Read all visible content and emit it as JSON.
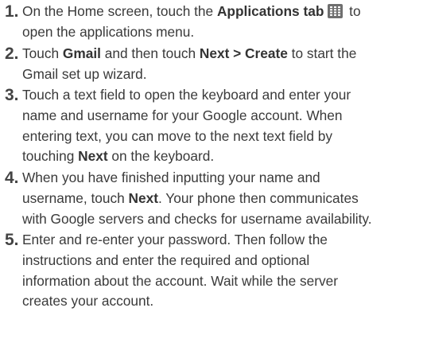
{
  "steps": [
    {
      "number": "1.",
      "lines": [
        {
          "segments": [
            "On the Home screen, touch the ",
            "Applications tab",
            "",
            " to"
          ]
        },
        {
          "segments": [
            "open the applications menu."
          ]
        }
      ],
      "icon": "apps-grid-icon"
    },
    {
      "number": "2.",
      "lines": [
        {
          "segments": [
            "Touch ",
            "Gmail",
            " and then touch ",
            "Next > Create",
            " to start the"
          ]
        },
        {
          "segments": [
            "Gmail set up wizard."
          ]
        }
      ]
    },
    {
      "number": "3.",
      "lines": [
        {
          "segments": [
            "Touch a text field to open the keyboard and enter your"
          ]
        },
        {
          "segments": [
            "name and username for your Google account. When"
          ]
        },
        {
          "segments": [
            "entering text, you can move to the next text field by"
          ]
        },
        {
          "segments": [
            "touching ",
            "Next",
            " on the keyboard."
          ]
        }
      ]
    },
    {
      "number": "4.",
      "lines": [
        {
          "segments": [
            "When you have finished inputting your name and"
          ]
        },
        {
          "segments": [
            "username, touch ",
            "Next",
            ". Your phone then communicates"
          ]
        },
        {
          "segments": [
            "with Google servers and checks for username availability."
          ]
        }
      ]
    },
    {
      "number": "5.",
      "lines": [
        {
          "segments": [
            "Enter and re-enter your password. Then follow the"
          ]
        },
        {
          "segments": [
            "instructions and enter the required and optional"
          ]
        },
        {
          "segments": [
            "information about the account. Wait while the server"
          ]
        },
        {
          "segments": [
            "creates your account."
          ]
        }
      ]
    }
  ]
}
